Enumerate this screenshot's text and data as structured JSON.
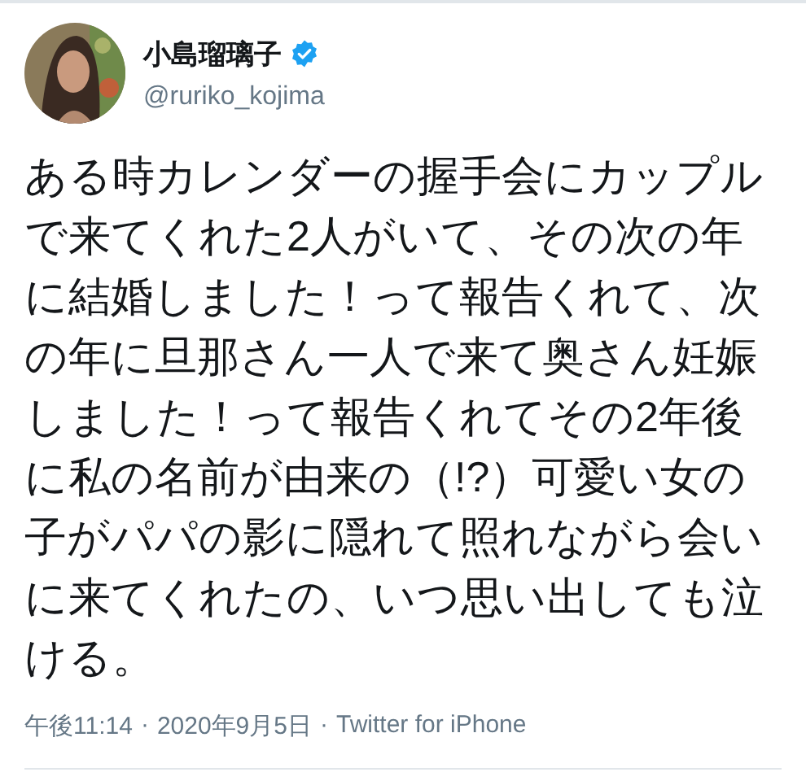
{
  "author": {
    "name": "小島瑠璃子",
    "verified": true,
    "handle": "@ruriko_kojima"
  },
  "tweet": {
    "text": "ある時カレンダーの握手会にカップルで来てくれた2人がいて、その次の年に結婚しました！って報告くれて、次の年に旦那さん一人で来て奥さん妊娠しました！って報告くれてその2年後に私の名前が由来の（!?）可愛い女の子がパパの影に隠れて照れながら会いに来てくれたの、いつ思い出しても泣ける。"
  },
  "meta": {
    "time": "午後11:14",
    "separator_1": "·",
    "date": "2020年9月5日",
    "separator_2": "·",
    "source": "Twitter for iPhone"
  }
}
